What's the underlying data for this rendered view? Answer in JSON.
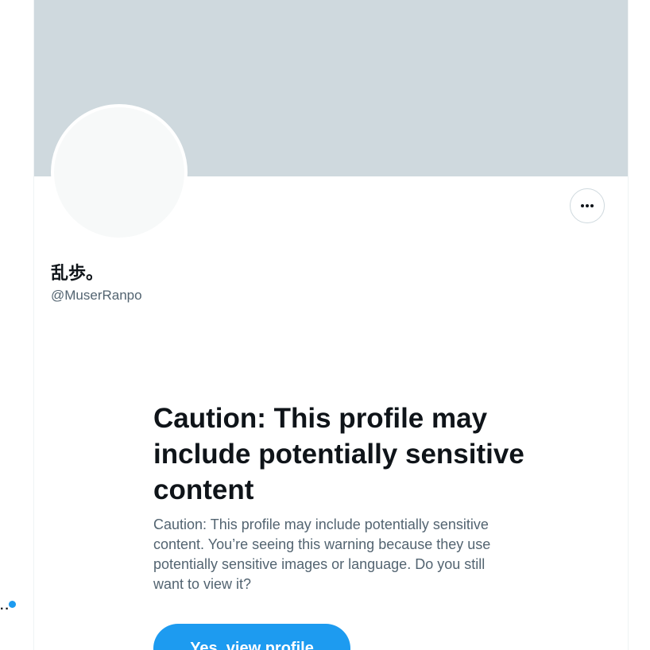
{
  "profile": {
    "display_name": "乱歩。",
    "handle": "@MuserRanpo"
  },
  "more_button_icon": "more-horizontal-icon",
  "warning": {
    "title": "Caution: This profile may include potentially sensitive content",
    "body": "Caution: This profile may include potentially sensitive content. You’re seeing this warning because they use potentially sensitive images or language. Do you still want to view it?",
    "view_button_label": "Yes, view profile"
  },
  "colors": {
    "banner": "#cfd9de",
    "avatar": "#f7f9f9",
    "accent": "#1d9bf0",
    "primary_text": "#0f1419",
    "secondary_text": "#536471"
  }
}
